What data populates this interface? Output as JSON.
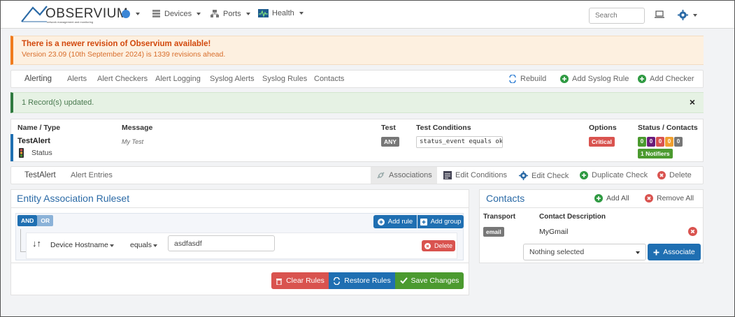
{
  "app": {
    "logo_text": "OBSERVIUM",
    "logo_tagline": "network management and monitoring"
  },
  "topnav": {
    "devices": "Devices",
    "ports": "Ports",
    "health": "Health",
    "search_placeholder": "Search"
  },
  "update_notice": {
    "title": "There is a newer revision of Observium available!",
    "detail": "Version 23.09 (10th September 2024) is 1339 revisions ahead."
  },
  "alerting_nav": {
    "brand": "Alerting",
    "items": [
      "Alerts",
      "Alert Checkers",
      "Alert Logging",
      "Syslog Alerts",
      "Syslog Rules",
      "Contacts"
    ],
    "rebuild": "Rebuild",
    "add_syslog_rule": "Add Syslog Rule",
    "add_checker": "Add Checker"
  },
  "status_message": "1 Record(s) updated.",
  "checker_table": {
    "headers": [
      "Name / Type",
      "Message",
      "Test",
      "Test Conditions",
      "Options",
      "Status / Contacts"
    ],
    "row": {
      "name": "TestAlert",
      "type": "Status",
      "message": "My Test",
      "test": "ANY",
      "condition": "status_event equals ok",
      "option": "Critical",
      "counts": [
        "0",
        "0",
        "0",
        "0",
        "0"
      ],
      "notifiers": "1 Notifiers"
    }
  },
  "checker_nav": {
    "brand": "TestAlert",
    "entries": "Alert Entries",
    "associations": "Associations",
    "edit_conditions": "Edit Conditions",
    "edit_check": "Edit Check",
    "duplicate_check": "Duplicate Check",
    "delete": "Delete"
  },
  "ruleset": {
    "title": "Entity Association Ruleset",
    "and": "AND",
    "or": "OR",
    "add_rule": "Add rule",
    "add_group": "Add group",
    "rule_field": "Device Hostname",
    "rule_operator": "equals",
    "rule_value": "asdfasdf",
    "rule_delete": "Delete",
    "clear_rules": "Clear Rules",
    "restore_rules": "Restore Rules",
    "save_changes": "Save Changes"
  },
  "contacts": {
    "title": "Contacts",
    "add_all": "Add All",
    "remove_all": "Remove All",
    "headers": [
      "Transport",
      "Contact Description"
    ],
    "row": {
      "transport": "email",
      "description": "MyGmail"
    },
    "select_placeholder": "Nothing selected",
    "associate": "Associate"
  },
  "colors": {
    "brand_blue": "#1f6fb2",
    "danger": "#d9534f",
    "success": "#4b9a2f",
    "warning_orange": "#f07b1d",
    "count_colors": [
      "#4b9a2f",
      "#6a1b7a",
      "#d9534f",
      "#f0a030",
      "#777777"
    ]
  }
}
